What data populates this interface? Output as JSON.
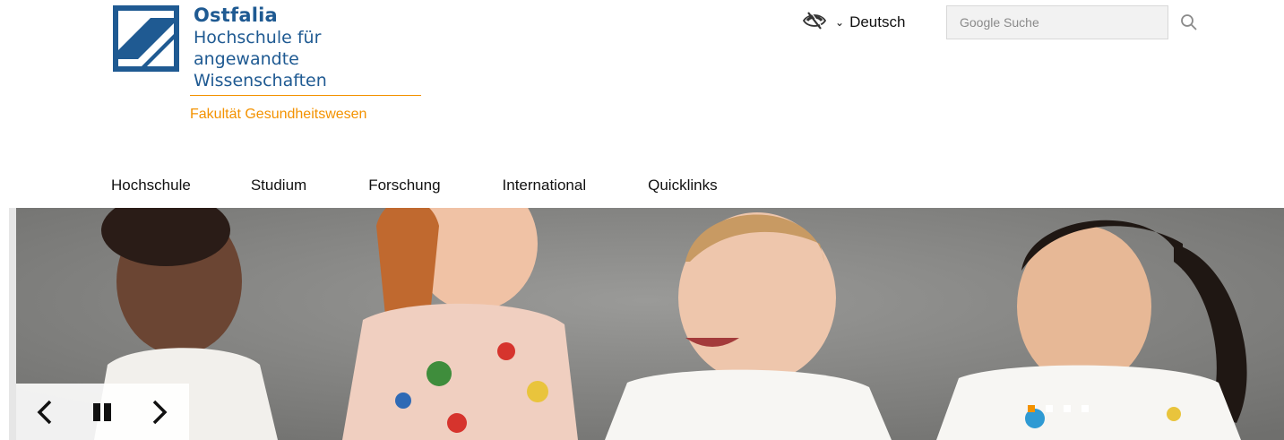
{
  "logo": {
    "name": "Ostfalia",
    "line1": "Hochschule für angewandte",
    "line2": "Wissenschaften",
    "color": "#1f5a92"
  },
  "faculty": "Fakultät Gesundheitswesen",
  "accent_color": "#f39200",
  "accessibility_icon": "hidden-eye-icon",
  "language": {
    "label": "Deutsch",
    "icon": "chevron-down-icon"
  },
  "search": {
    "placeholder": "Google Suche",
    "value": "",
    "icon": "search-icon"
  },
  "nav": {
    "items": [
      {
        "label": "Hochschule"
      },
      {
        "label": "Studium"
      },
      {
        "label": "Forschung"
      },
      {
        "label": "International"
      },
      {
        "label": "Quicklinks"
      }
    ]
  },
  "hero": {
    "image": "children-with-paint-stained-shirts-photo",
    "controls": [
      "previous-icon",
      "pause-icon",
      "next-icon"
    ],
    "slide_count": 4,
    "active_slide": 1
  }
}
